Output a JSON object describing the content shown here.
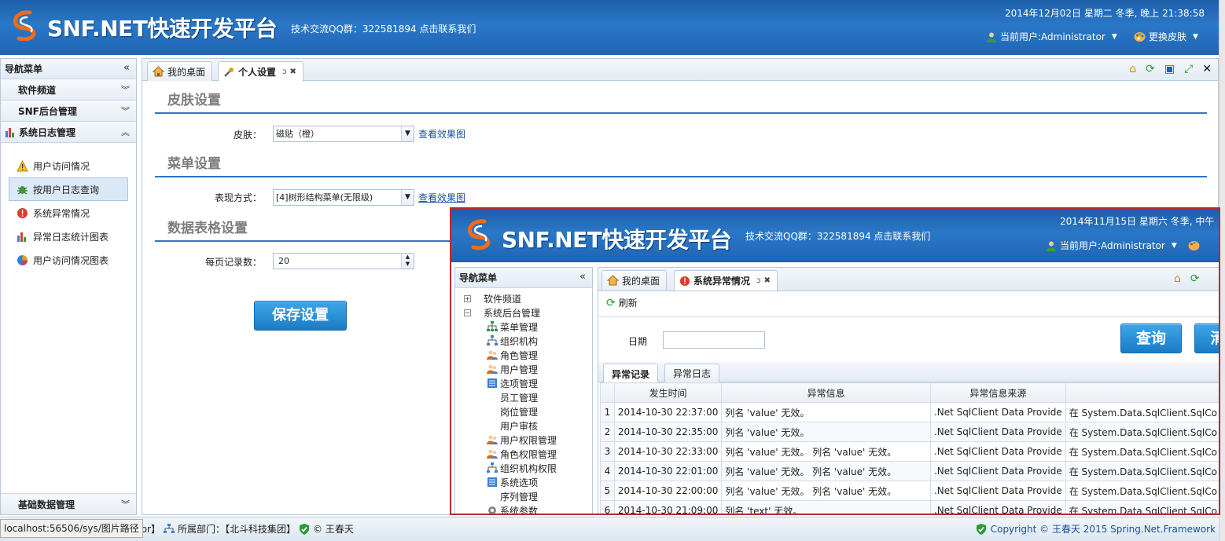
{
  "header": {
    "brand": "SNF.NET快速开发平台",
    "qq_text": "技术交流QQ群：322581894 点击联系我们",
    "datetime": "2014年12月02日 星期二 冬季, 晚上 21:38:58",
    "user_label": "当前用户:Administrator",
    "skin_label": "更换皮肤"
  },
  "nav": {
    "title": "导航菜单",
    "groups": [
      {
        "label": "软件频道"
      },
      {
        "label": "SNF后台管理"
      },
      {
        "label": "系统日志管理"
      }
    ],
    "items": [
      {
        "label": "用户访问情况",
        "icon": "warning-icon"
      },
      {
        "label": "按用户日志查询",
        "icon": "bug-icon"
      },
      {
        "label": "系统异常情况",
        "icon": "error-icon"
      },
      {
        "label": "异常日志统计图表",
        "icon": "bar-chart-icon"
      },
      {
        "label": "用户访问情况图表",
        "icon": "pie-chart-icon"
      }
    ],
    "bottom_group": "基础数据管理"
  },
  "tabs": [
    {
      "label": "我的桌面"
    },
    {
      "label": "个人设置"
    }
  ],
  "tab_refresh": "ↄ",
  "settings": {
    "skin_section": "皮肤设置",
    "skin_label": "皮肤：",
    "skin_value": "磁贴（橙）",
    "view_effect": "查看效果图",
    "menu_section": "菜单设置",
    "menu_label": "表现方式：",
    "menu_value": "[4]树形结构菜单(无限级)",
    "grid_section": "数据表格设置",
    "per_page_label": "每页记录数：",
    "per_page_value": "20",
    "save_button": "保存设置"
  },
  "footer": {
    "url": "localhost:56506/sys/图片路径",
    "tail": "tor】",
    "dept": "所属部门：【北斗科技集团】",
    "author": "© 王春天",
    "copyright": "Copyright © 王春天 2015 Spring.Net.Framework"
  },
  "inner": {
    "brand": "SNF.NET快速开发平台",
    "qq_text": "技术交流QQ群：322581894 点击联系我们",
    "datetime": "2014年11月15日 星期六 冬季, 中午",
    "user_label": "当前用户:Administrator",
    "nav_title": "导航菜单",
    "tree": [
      {
        "label": "软件频道",
        "type": "plus"
      },
      {
        "label": "系统后台管理",
        "type": "minus"
      },
      {
        "label": "菜单管理",
        "type": "child",
        "icon": "sitemap-icon"
      },
      {
        "label": "组织机构",
        "type": "child",
        "icon": "org-icon"
      },
      {
        "label": "角色管理",
        "type": "child",
        "icon": "users-icon"
      },
      {
        "label": "用户管理",
        "type": "child",
        "icon": "users-icon"
      },
      {
        "label": "选项管理",
        "type": "child",
        "icon": "list-icon"
      },
      {
        "label": "员工管理",
        "type": "child",
        "icon": ""
      },
      {
        "label": "岗位管理",
        "type": "child",
        "icon": ""
      },
      {
        "label": "用户审核",
        "type": "child",
        "icon": ""
      },
      {
        "label": "用户权限管理",
        "type": "child",
        "icon": "users-icon"
      },
      {
        "label": "角色权限管理",
        "type": "child",
        "icon": "users-icon"
      },
      {
        "label": "组织机构权限",
        "type": "child",
        "icon": "org-icon"
      },
      {
        "label": "系统选项",
        "type": "child",
        "icon": "list-icon"
      },
      {
        "label": "序列管理",
        "type": "child",
        "icon": ""
      },
      {
        "label": "系统参数",
        "type": "child",
        "icon": "gear-icon"
      }
    ],
    "tabs": [
      {
        "label": "我的桌面"
      },
      {
        "label": "系统异常情况"
      }
    ],
    "refresh": "刷新",
    "date_label": "日期",
    "query_button": "查询",
    "clear_button": "清",
    "sub_tabs": [
      "异常记录",
      "异常日志"
    ],
    "columns": [
      "",
      "发生时间",
      "异常信息",
      "异常信息来源",
      ""
    ],
    "rows": [
      {
        "n": "1",
        "time": "2014-10-30 22:37:00",
        "msg": "列名 'value' 无效。",
        "src": ".Net SqlClient Data Provide",
        "stack": "在 System.Data.SqlClient.SqlCo"
      },
      {
        "n": "2",
        "time": "2014-10-30 22:35:00",
        "msg": "列名 'value' 无效。",
        "src": ".Net SqlClient Data Provide",
        "stack": "在 System.Data.SqlClient.SqlCo"
      },
      {
        "n": "3",
        "time": "2014-10-30 22:33:00",
        "msg": "列名 'value' 无效。 列名 'value' 无效。",
        "src": ".Net SqlClient Data Provide",
        "stack": "在 System.Data.SqlClient.SqlCo"
      },
      {
        "n": "4",
        "time": "2014-10-30 22:01:00",
        "msg": "列名 'value' 无效。 列名 'value' 无效。",
        "src": ".Net SqlClient Data Provide",
        "stack": "在 System.Data.SqlClient.SqlCo"
      },
      {
        "n": "5",
        "time": "2014-10-30 22:00:00",
        "msg": "列名 'value' 无效。 列名 'value' 无效。",
        "src": ".Net SqlClient Data Provide",
        "stack": "在 System.Data.SqlClient.SqlCo"
      },
      {
        "n": "6",
        "time": "2014-10-30 21:09:00",
        "msg": "列名 'text' 无效。",
        "src": ".Net SqlClient Data Provide",
        "stack": "在 System.Data.SqlClient.SqlCo"
      }
    ]
  },
  "colors": {
    "header_blue": "#2a78c8",
    "accent_red": "#c0272d",
    "button_blue": "#1b7bc6"
  }
}
